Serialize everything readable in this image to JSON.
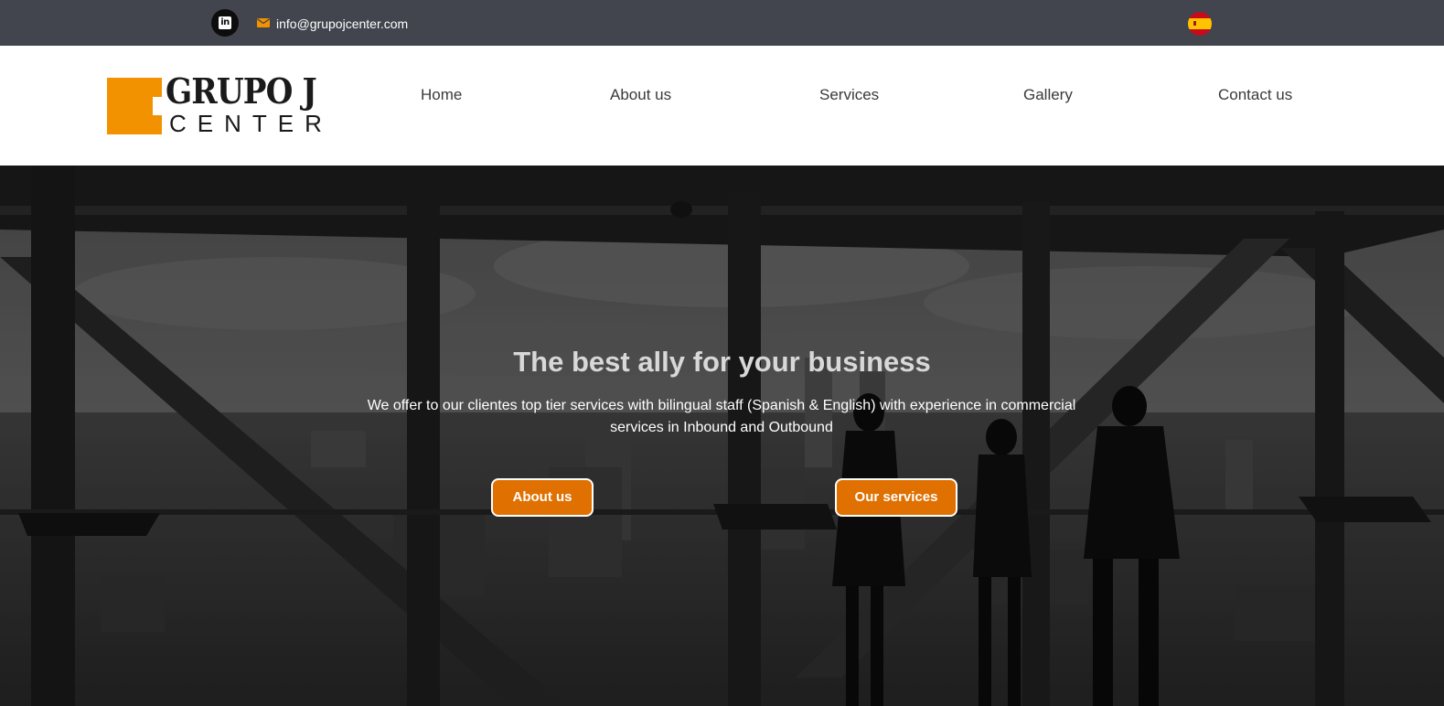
{
  "topbar": {
    "linkedin_icon": "linkedin-icon",
    "mail_icon": "envelope-icon",
    "email": "info@grupojcenter.com",
    "language_flag_icon": "spain-flag-icon"
  },
  "logo": {
    "line1": "GRUPO J",
    "line2": "CENTER",
    "accent_color": "#f39200"
  },
  "nav": {
    "items": [
      {
        "label": "Home"
      },
      {
        "label": "About us"
      },
      {
        "label": "Services"
      },
      {
        "label": "Gallery"
      },
      {
        "label": "Contact us"
      }
    ]
  },
  "hero": {
    "title": "The best ally for your business",
    "subtitle": "We offer to our clientes top tier services with bilingual staff (Spanish & English) with experience in commercial services in Inbound and Outbound",
    "buttons": [
      {
        "label": "About us"
      },
      {
        "label": "Our services"
      }
    ]
  },
  "colors": {
    "topbar_bg": "#42454e",
    "button_bg": "#e07000",
    "accent": "#f39200"
  }
}
